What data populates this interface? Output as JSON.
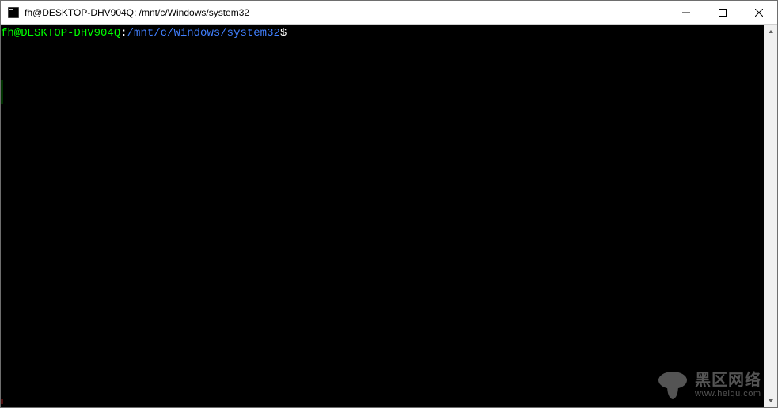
{
  "window": {
    "title": "fh@DESKTOP-DHV904Q: /mnt/c/Windows/system32"
  },
  "prompt": {
    "user_host": "fh@DESKTOP-DHV904Q",
    "separator": ":",
    "path": "/mnt/c/Windows/system32",
    "symbol": "$"
  },
  "watermark": {
    "title": "黑区网络",
    "url": "www.heiqu.com"
  }
}
